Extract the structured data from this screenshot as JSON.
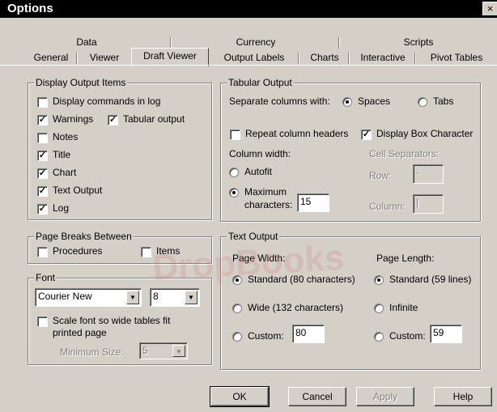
{
  "window": {
    "title": "Options",
    "close": "×"
  },
  "tabs": {
    "row1": [
      "Data",
      "Currency",
      "Scripts"
    ],
    "row2": [
      "General",
      "Viewer",
      "Draft Viewer",
      "Output Labels",
      "Charts",
      "Interactive",
      "Pivot Tables"
    ]
  },
  "display_output": {
    "title": "Display Output Items",
    "items": [
      {
        "label": "Display commands in log",
        "checked": false
      },
      {
        "label": "Warnings",
        "checked": true
      },
      {
        "label": "Tabular output",
        "checked": true
      },
      {
        "label": "Notes",
        "checked": false
      },
      {
        "label": "Title",
        "checked": true
      },
      {
        "label": "Chart",
        "checked": true
      },
      {
        "label": "Text Output",
        "checked": true
      },
      {
        "label": "Log",
        "checked": true
      }
    ]
  },
  "page_breaks": {
    "title": "Page Breaks Between",
    "procedures": {
      "label": "Procedures",
      "checked": false
    },
    "items": {
      "label": "Items",
      "checked": false
    }
  },
  "font": {
    "title": "Font",
    "family_value": "Courier New",
    "size_value": "8",
    "scale_label_1": "Scale font so wide tables fit",
    "scale_label_2": "printed page",
    "min_size_label": "Minimum Size:",
    "min_size_value": "5"
  },
  "tabular_output": {
    "title": "Tabular Output",
    "separate_label": "Separate columns with:",
    "spaces_label": "Spaces",
    "tabs_label": "Tabs",
    "repeat_label": "Repeat column headers",
    "repeat_checked": false,
    "box_label": "Display Box Character",
    "box_checked": true,
    "col_width_label": "Column width:",
    "autofit_label": "Autofit",
    "maximum_label": "Maximum",
    "characters_label": "characters:",
    "maximum_value": "15",
    "cell_sep_label": "Cell Separators:",
    "row_label": "Row:",
    "row_value": "-",
    "column_label": "Column:",
    "column_value": "|"
  },
  "text_output": {
    "title": "Text Output",
    "page_width_label": "Page Width:",
    "page_length_label": "Page Length:",
    "standard_width": "Standard (80 characters)",
    "wide_width": "Wide (132 characters)",
    "custom_label": "Custom:",
    "custom_width_value": "80",
    "standard_length": "Standard (59 lines)",
    "infinite_label": "Infinite",
    "custom_length_value": "59"
  },
  "buttons": {
    "ok": "OK",
    "cancel": "Cancel",
    "apply": "Apply",
    "help": "Help"
  },
  "watermark": "DropBooks"
}
